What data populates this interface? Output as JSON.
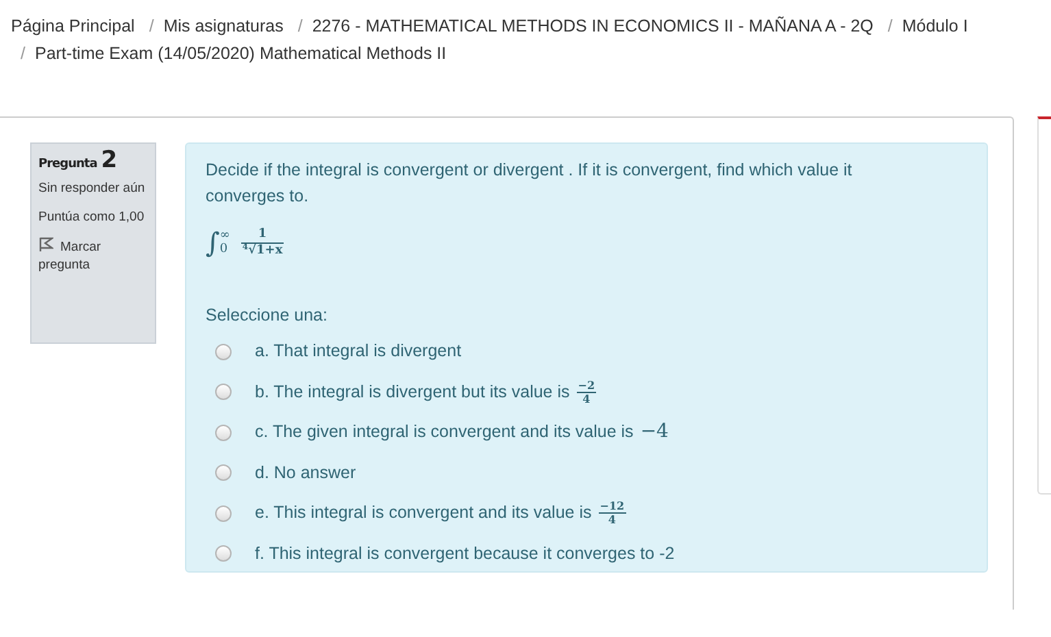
{
  "breadcrumb_separator": "/",
  "breadcrumb": [
    "Página Principal",
    "Mis asignaturas",
    "2276 - MATHEMATICAL METHODS IN ECONOMICS II - MAÑANA A - 2Q",
    "Módulo I",
    "Part-time Exam (14/05/2020) Mathematical Methods II"
  ],
  "question_info": {
    "label": "Pregunta",
    "number": "2",
    "state": "Sin responder aún",
    "grade": "Puntúa como 1,00",
    "flag": "Marcar pregunta"
  },
  "question": {
    "text": "Decide if the integral is convergent or divergent . If it is convergent, find which value it converges to.",
    "formula": {
      "integral_sign": "∫",
      "root_sign": "√",
      "lower": "0",
      "upper": "∞",
      "numerator": "1",
      "root_index": "4",
      "radicand": "1+x"
    },
    "prompt": "Seleccione una:",
    "options": [
      {
        "text": "a. That integral is divergent",
        "selected": false
      },
      {
        "text": "b. The integral  is divergent but its value is",
        "selected": false,
        "math": {
          "kind": "fraction",
          "numerator": "−2",
          "denominator": "4"
        }
      },
      {
        "text": "c. The given integral is convergent and its value is",
        "selected": false,
        "math": {
          "kind": "value",
          "text": "−4"
        }
      },
      {
        "text": "d. No answer",
        "selected": false
      },
      {
        "text": "e. This integral is convergent and its value is",
        "selected": false,
        "math": {
          "kind": "fraction",
          "numerator": "−12",
          "denominator": "4"
        }
      },
      {
        "text": "f. This integral is  convergent because it converges to -2",
        "selected": false
      }
    ]
  }
}
